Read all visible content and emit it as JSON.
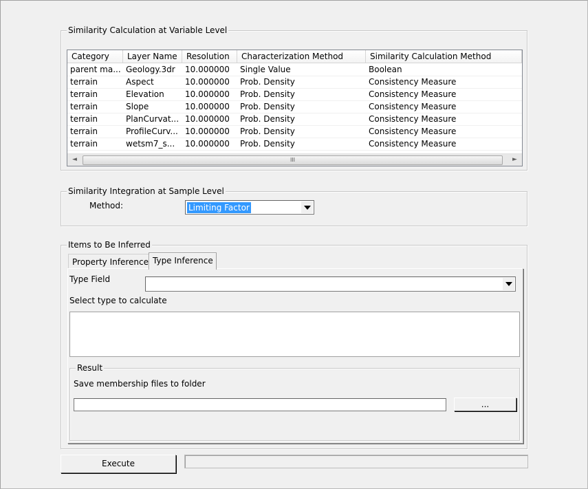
{
  "variable_group": {
    "title": "Similarity Calculation at Variable Level",
    "columns": [
      "Category",
      "Layer Name",
      "Resolution",
      "Characterization Method",
      "Similarity Calculation Method"
    ],
    "rows": [
      [
        "parent ma...",
        "Geology.3dr",
        "10.000000",
        "Single Value",
        "Boolean"
      ],
      [
        "terrain",
        "Aspect",
        "10.000000",
        "Prob. Density",
        "Consistency Measure"
      ],
      [
        "terrain",
        "Elevation",
        "10.000000",
        "Prob. Density",
        "Consistency Measure"
      ],
      [
        "terrain",
        "Slope",
        "10.000000",
        "Prob. Density",
        "Consistency Measure"
      ],
      [
        "terrain",
        "PlanCurvat...",
        "10.000000",
        "Prob. Density",
        "Consistency Measure"
      ],
      [
        "terrain",
        "ProfileCurv...",
        "10.000000",
        "Prob. Density",
        "Consistency Measure"
      ],
      [
        "terrain",
        "wetsm7_s...",
        "10.000000",
        "Prob. Density",
        "Consistency Measure"
      ]
    ],
    "scrollbar": {
      "left_glyph": "◄",
      "right_glyph": "►",
      "grip": "III"
    }
  },
  "integration_group": {
    "title": "Similarity Integration at Sample Level",
    "method_label": "Method:",
    "method_value": "Limiting Factor"
  },
  "infer_group": {
    "title": "Items to Be Inferred",
    "tabs": [
      "Property Inference",
      "Type Inference"
    ],
    "active_tab": "Type Inference",
    "type_field_label": "Type Field",
    "type_field_value": "",
    "select_type_label": "Select type to calculate",
    "result": {
      "title": "Result",
      "save_label": "Save membership files to folder",
      "folder_value": "",
      "browse_label": "..."
    }
  },
  "execute_label": "Execute"
}
